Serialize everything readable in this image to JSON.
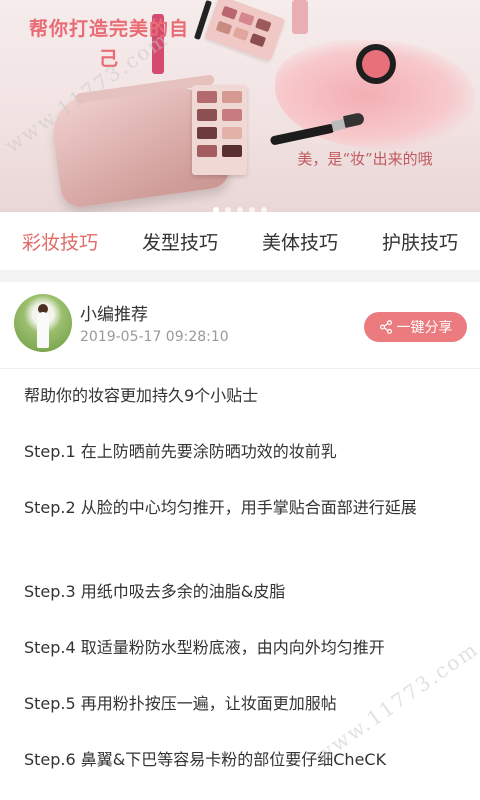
{
  "banner": {
    "title": "帮你打造完美的自己",
    "slogan": "美，是“妆”出来的哦",
    "watermark": "www.11773.com",
    "slides": [
      true,
      false,
      false,
      false,
      false
    ]
  },
  "tabs": [
    {
      "label": "彩妆技巧",
      "active": true
    },
    {
      "label": "发型技巧",
      "active": false
    },
    {
      "label": "美体技巧",
      "active": false
    },
    {
      "label": "护肤技巧",
      "active": false
    }
  ],
  "author": {
    "name": "小编推荐",
    "time": "2019-05-17 09:28:10",
    "share_label": "一键分享",
    "share_icon": "share-icon"
  },
  "article": {
    "lines": [
      "帮助你的妆容更加持久9个小贴士",
      "Step.1 在上防晒前先要涂防晒功效的妆前乳",
      "Step.2 从脸的中心均匀推开，用手掌贴合面部进行延展",
      "Step.3 用纸巾吸去多余的油脂&皮脂",
      "Step.4 取适量粉防水型粉底液，由内向外均匀推开",
      "Step.5 再用粉扑按压一遍，让妆面更加服帖",
      "Step.6 鼻翼&下巴等容易卡粉的部位要仔细CheCK"
    ]
  },
  "colors": {
    "accent": "#e26b66",
    "share_button": "#ec7b7f",
    "banner_title": "#ea6b74"
  }
}
